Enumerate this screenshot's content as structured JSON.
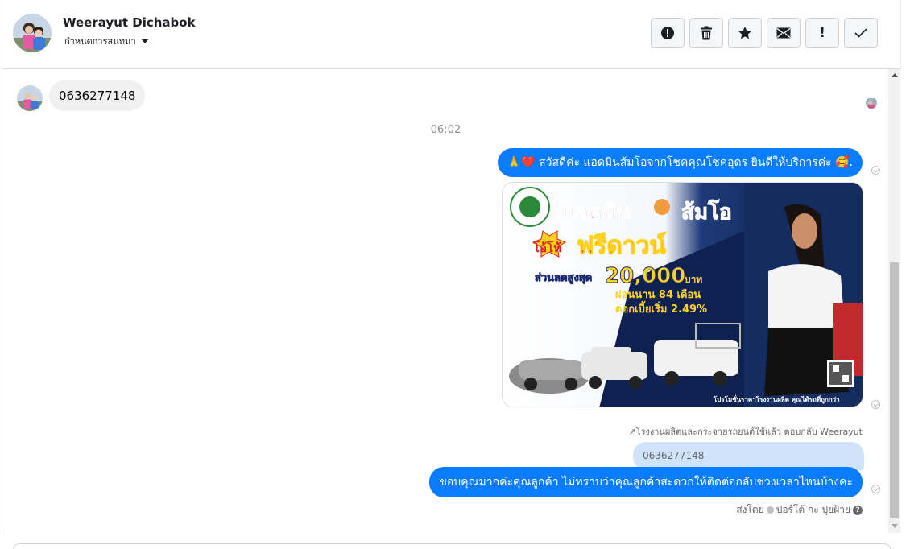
{
  "header": {
    "contact_name": "Weerayut Dichabok",
    "subtitle": "กำหนดการสนทนา",
    "toolbar": [
      {
        "icon": "alert-circle-icon",
        "label": ""
      },
      {
        "icon": "trash-icon",
        "label": ""
      },
      {
        "icon": "star-icon",
        "label": ""
      },
      {
        "icon": "envelope-icon",
        "label": ""
      },
      {
        "icon": "exclamation-icon",
        "label": "!"
      },
      {
        "icon": "checkmark-icon",
        "label": ""
      }
    ]
  },
  "thread": {
    "incoming_message": "0636277148",
    "time_separator": "06:02",
    "outgoing_greeting_prefix": "🙏❤️",
    "outgoing_greeting": "สวัสดีค่ะ แอดมินส้มโอจากโชคคุณโชคอุดร ยินดีให้บริการค่ะ",
    "outgoing_greeting_suffix": "🥰.",
    "promo_image": {
      "title_left": "แอดมิน",
      "title_right": "ส้มโอ",
      "badge": "โอ้โห้",
      "headline": "ฟรีดาวน์",
      "discount_label": "ส่วนลดสูงสุด",
      "discount_amount": "20,000",
      "discount_unit": "บาท",
      "installment": "ผ่อนนาน 84 เดือน",
      "interest": "ดอกเบี้ยเริ่ม 2.49%",
      "footer": "โปรโมชั่นราคาโรงงานผลิต คุณได้รถที่ถูกกว่า"
    },
    "reply_meta": "↗โรงงานผลิตและกระจายรถยนต์ใช้แล้ว ตอบกลับ Weerayut",
    "quoted_text": "0636277148",
    "outgoing_reply": "ขอบคุณมากค่ะคุณลูกค้า ไม่ทราบว่าคุณลูกค้าสะดวกให้ติดต่อกลับช่วงเวลาไหนบ้างคะ",
    "sent_by_label": "ส่งโดย",
    "sent_by_name": "ปอร์โต้ กะ ปุยฝ้าย"
  },
  "colors": {
    "outgoing_bubble": "#0a7cff",
    "incoming_bubble": "#f0f0f0",
    "quoted_bubble": "#cfe3fb"
  }
}
